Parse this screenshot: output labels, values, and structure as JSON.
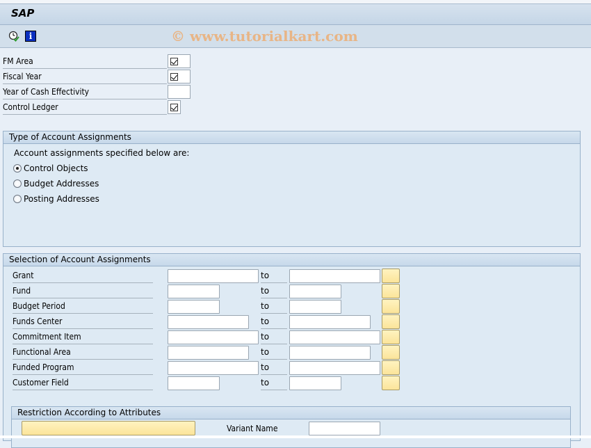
{
  "window": {
    "title": "SAP",
    "watermark": "© www.tutorialkart.com"
  },
  "toolbar": {
    "icons": [
      {
        "name": "execute-icon",
        "label": "Execute"
      },
      {
        "name": "info-icon",
        "glyph": "i"
      }
    ]
  },
  "header_fields": [
    {
      "label": "FM Area",
      "checked": true
    },
    {
      "label": "Fiscal Year",
      "checked": true
    },
    {
      "label": "Year of Cash Effectivity",
      "checked": false
    },
    {
      "label": "Control Ledger",
      "checked": true
    }
  ],
  "type_group": {
    "title": "Type of Account Assignments",
    "intro": "Account assignments specified below are:",
    "options": [
      {
        "label": "Control Objects",
        "selected": true
      },
      {
        "label": "Budget Addresses",
        "selected": false
      },
      {
        "label": "Posting Addresses",
        "selected": false
      }
    ]
  },
  "selection_group": {
    "title": "Selection of Account Assignments",
    "to_label": "to",
    "rows": [
      {
        "label": "Grant",
        "from": "",
        "to": ""
      },
      {
        "label": "Fund",
        "from": "",
        "to": ""
      },
      {
        "label": "Budget Period",
        "from": "",
        "to": ""
      },
      {
        "label": "Funds Center",
        "from": "",
        "to": ""
      },
      {
        "label": "Commitment Item",
        "from": "",
        "to": ""
      },
      {
        "label": "Functional Area",
        "from": "",
        "to": ""
      },
      {
        "label": "Funded Program",
        "from": "",
        "to": ""
      },
      {
        "label": "Customer Field",
        "from": "",
        "to": ""
      }
    ]
  },
  "restriction_group": {
    "title": "Restriction According to Attributes",
    "button_label": "",
    "variant_label": "Variant Name",
    "variant_value": ""
  }
}
